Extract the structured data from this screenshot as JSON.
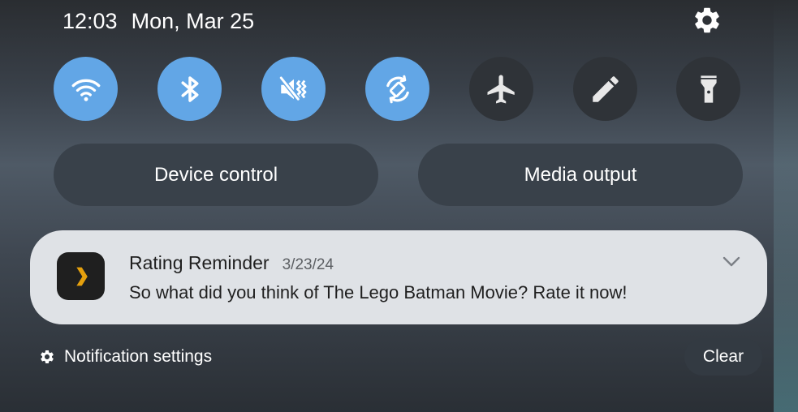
{
  "status_bar": {
    "time": "12:03",
    "date": "Mon, Mar 25"
  },
  "quick_toggles": [
    {
      "name": "wifi",
      "icon": "wifi-icon",
      "state": "on"
    },
    {
      "name": "bluetooth",
      "icon": "bluetooth-icon",
      "state": "on"
    },
    {
      "name": "sound",
      "icon": "vibrate-mute-icon",
      "state": "on"
    },
    {
      "name": "auto-rotate",
      "icon": "auto-rotate-icon",
      "state": "on"
    },
    {
      "name": "airplane-mode",
      "icon": "airplane-icon",
      "state": "off"
    },
    {
      "name": "edit",
      "icon": "pencil-icon",
      "state": "off"
    },
    {
      "name": "flashlight",
      "icon": "flashlight-icon",
      "state": "off"
    }
  ],
  "buttons": {
    "device_control": "Device control",
    "media_output": "Media output"
  },
  "notification": {
    "app_icon": "plex-chevron-icon",
    "title": "Rating Reminder",
    "date": "3/23/24",
    "body": "So what did you think of The Lego Batman Movie? Rate it now!"
  },
  "footer": {
    "settings_label": "Notification settings",
    "clear_label": "Clear"
  },
  "colors": {
    "toggle_on": "#62a6e6",
    "toggle_off": "#2f3338",
    "notification_bg": "#dfe2e6",
    "plex_accent": "#e5a00d"
  }
}
